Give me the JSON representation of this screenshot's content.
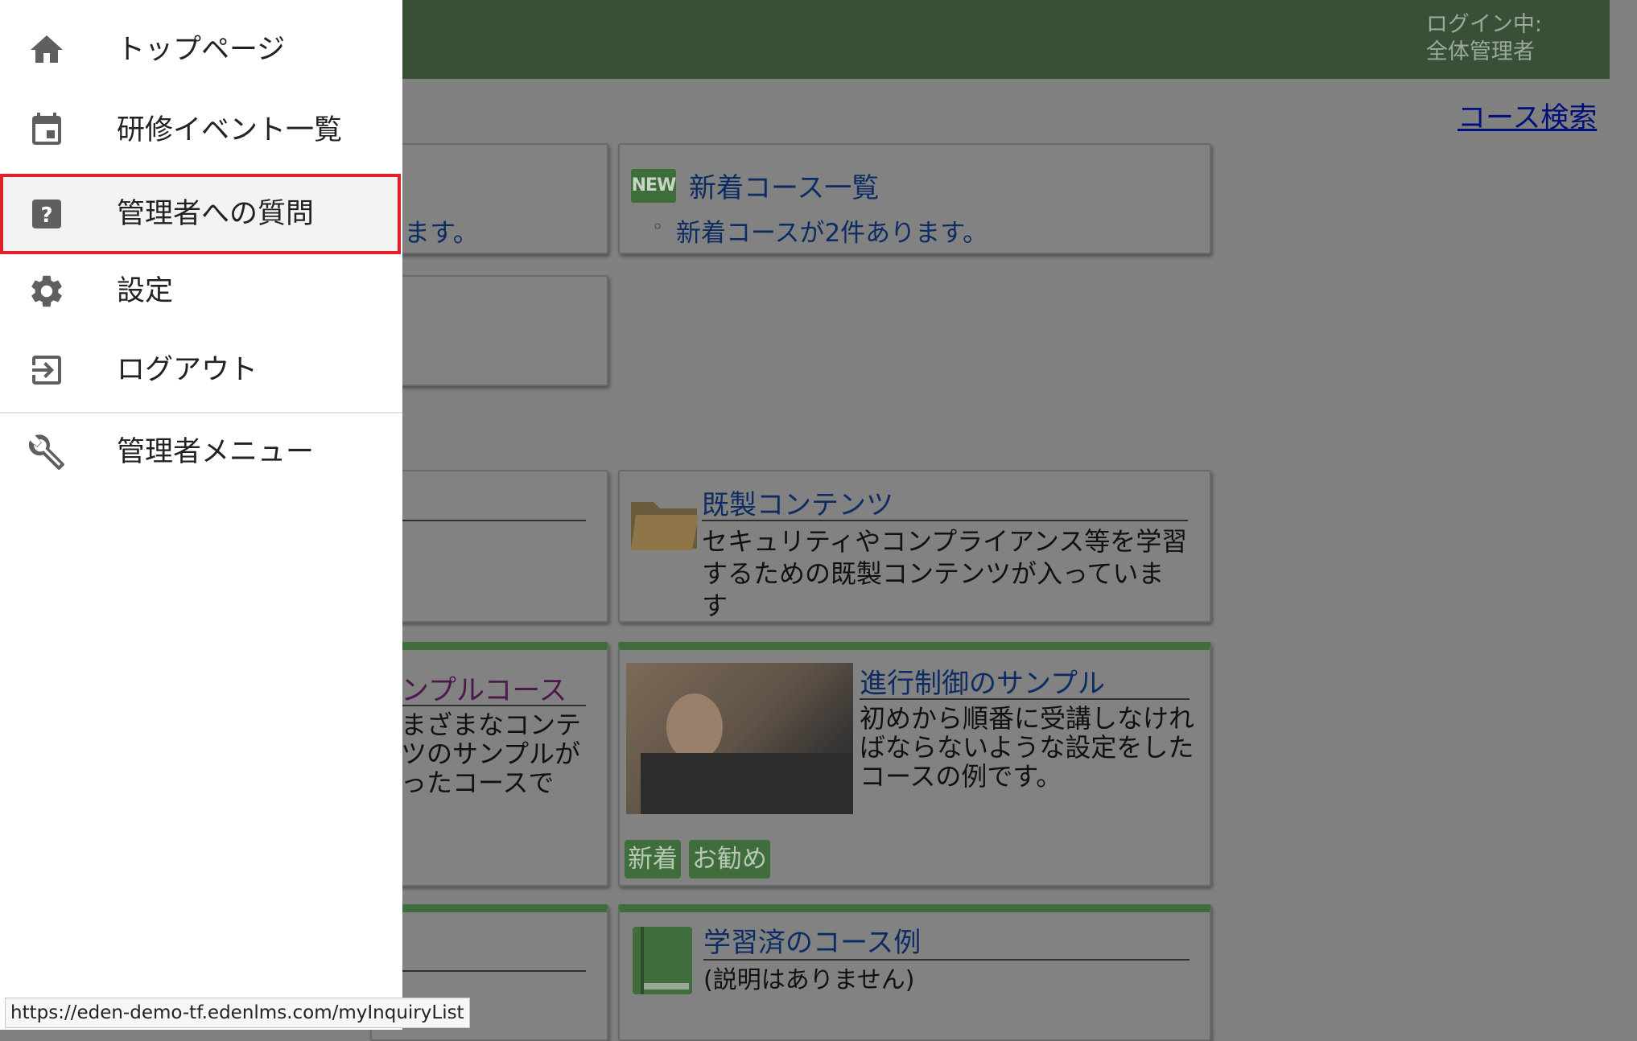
{
  "header": {
    "login_label": "ログイン中:",
    "user_name": "全体管理者",
    "course_search_link": "コース検索"
  },
  "cards": {
    "partial_text": "ます。",
    "new_courses": {
      "badge": "NEW",
      "title": "新着コース一覧",
      "bullet": "◦",
      "info": "新着コースが2件あります。"
    },
    "ready_made": {
      "title": "既製コンテンツ",
      "desc_line1": "セキュリティやコンプライアンス等を学習",
      "desc_line2": "するための既製コンテンツが入っていま",
      "desc_line3": "す"
    },
    "sample_course": {
      "title_partial": "ンプルコース",
      "desc_line1": "まざまなコンテ",
      "desc_line2": "ツのサンプルが",
      "desc_line3": "ったコースで"
    },
    "progress_sample": {
      "title": "進行制御のサンプル",
      "desc_line1": "初めから順番に受講しなけれ",
      "desc_line2": "ばならないような設定をした",
      "desc_line3": "コースの例です。",
      "tags": [
        "新着",
        "お勧め"
      ]
    },
    "completed_example": {
      "title": "学習済のコース例",
      "desc": "(説明はありません)"
    }
  },
  "drawer": {
    "items": [
      {
        "label": "トップページ",
        "icon": "home-icon"
      },
      {
        "label": "研修イベント一覧",
        "icon": "calendar-icon"
      },
      {
        "label": "管理者への質問",
        "icon": "help-icon"
      },
      {
        "label": "設定",
        "icon": "gear-icon"
      },
      {
        "label": "ログアウト",
        "icon": "logout-icon"
      },
      {
        "label": "管理者メニュー",
        "icon": "wrench-icon"
      }
    ]
  },
  "status_bar": {
    "url": "https://eden-demo-tf.edenlms.com/myInquiryList"
  },
  "colors": {
    "header_green": "#3f6d3b",
    "highlight_border": "#e0202a",
    "link_blue": "#0c2c63"
  }
}
